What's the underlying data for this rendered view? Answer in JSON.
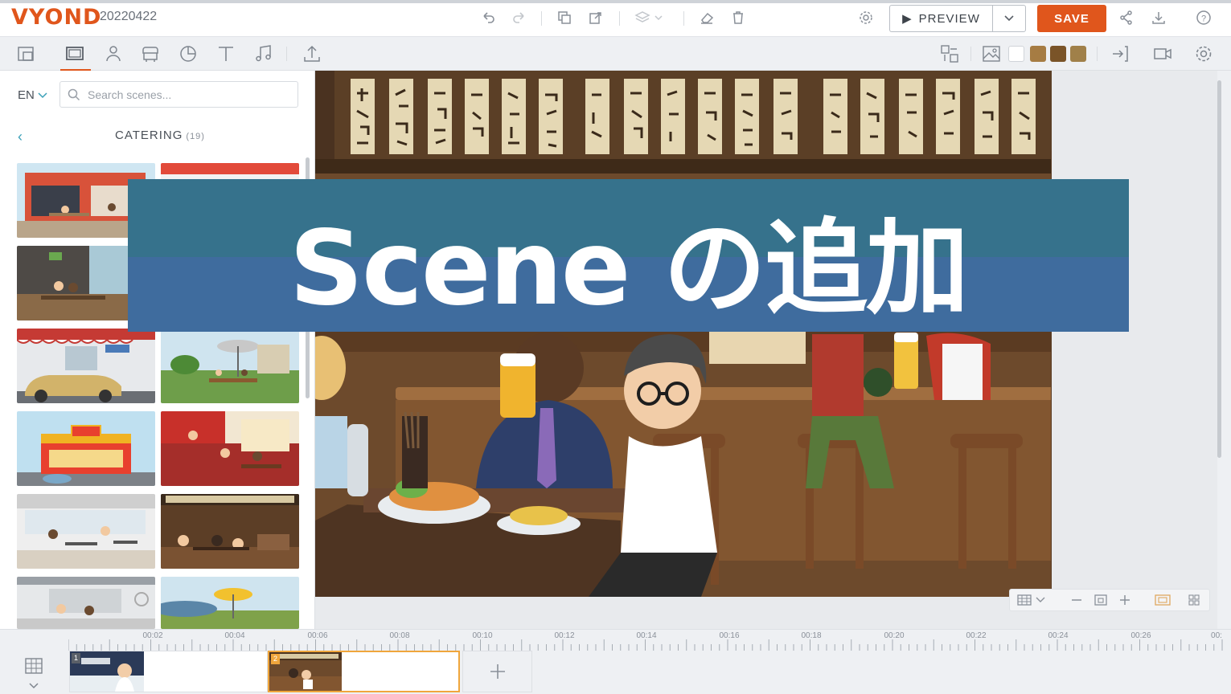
{
  "app": {
    "logo": "VYOND",
    "project_title": "20220422"
  },
  "toolbar": {
    "preview_label": "PREVIEW",
    "save_label": "SAVE",
    "brand_color": "#e0561c"
  },
  "toolbar2": {
    "tools": [
      "scene-library-icon",
      "scene-icon",
      "character-icon",
      "prop-icon",
      "chart-icon",
      "text-icon",
      "audio-icon",
      "upload-icon"
    ],
    "right_tools": [
      "layout-icon",
      "background-image-icon",
      "exit-icon",
      "camera-icon",
      "settings-icon"
    ],
    "swatches": [
      "#ffffff",
      "#a67c43",
      "#7a5428",
      "#a08049"
    ]
  },
  "panel": {
    "language": "EN",
    "search_placeholder": "Search scenes...",
    "category_title": "CATERING",
    "category_count": "(19)"
  },
  "banner": {
    "text": "Scene の追加"
  },
  "timeline": {
    "ticks": [
      "00:02",
      "00:04",
      "00:06",
      "00:08",
      "00:10",
      "00:12",
      "00:14",
      "00:16",
      "00:18",
      "00:20",
      "00:22",
      "00:24",
      "00:26",
      "00:"
    ],
    "scenes": [
      {
        "number": "1"
      },
      {
        "number": "2"
      }
    ]
  }
}
